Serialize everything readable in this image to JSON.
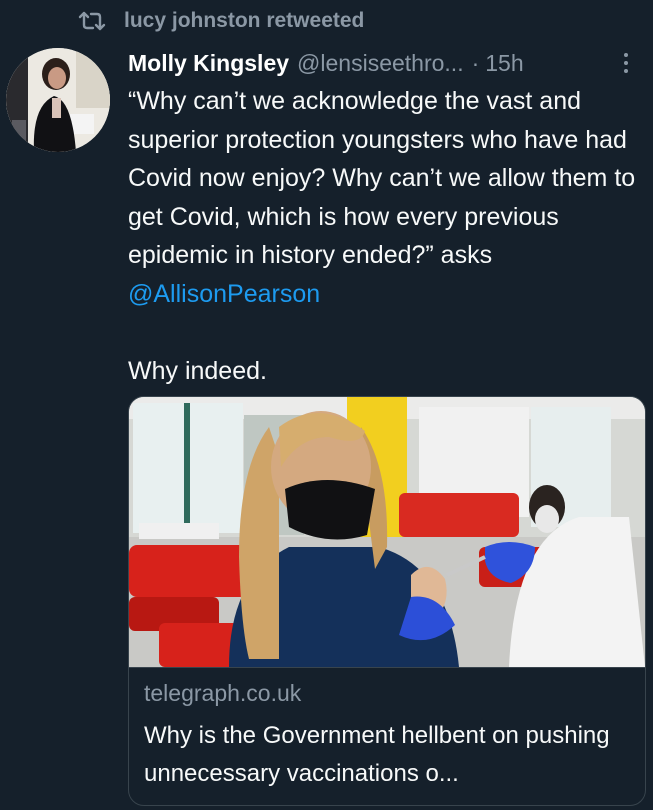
{
  "retweet": {
    "label": "lucy johnston retweeted",
    "icon": "retweet-icon"
  },
  "tweet": {
    "author_name": "Molly Kingsley",
    "handle": "@lensiseethro...",
    "separator": "·",
    "time": "15h",
    "text_before_mention": "“Why can’t we acknowledge the vast and superior protection youngsters who have had Covid now enjoy? Why can’t we allow them to get Covid, which is how every previous epidemic in history ended?” asks ",
    "mention": "@AllisonPearson",
    "text_after": "Why indeed."
  },
  "card": {
    "domain": "telegraph.co.uk",
    "title": "Why is the Government hellbent on pushing unnecessary vaccinations o..."
  },
  "colors": {
    "background": "#15202b",
    "secondary_text": "#8b98a5",
    "link": "#1d9bf0",
    "border": "#38444d"
  }
}
